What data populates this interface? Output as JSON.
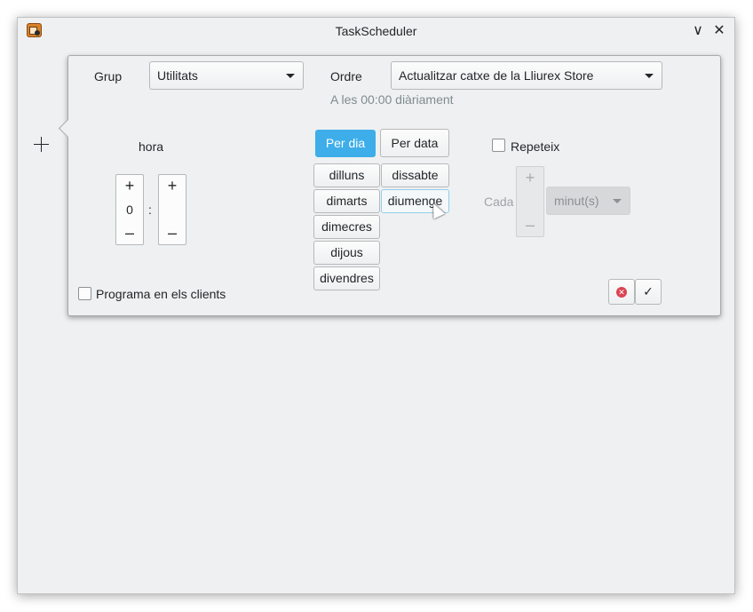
{
  "window": {
    "title": "TaskScheduler"
  },
  "titlebar": {
    "minimize_glyph": "∨",
    "close_glyph": "✕",
    "app_icon": "taskscheduler-app-icon"
  },
  "form": {
    "group_label": "Grup",
    "group_value": "Utilitats",
    "order_label": "Ordre",
    "order_value": "Actualitzar catxe de la Lliurex Store",
    "schedule_summary": "A les 00:00 diàriament",
    "hour_label": "hora",
    "hour_value": "0",
    "time_separator": ":",
    "minute_value": "",
    "spin_plus": "+",
    "spin_minus": "–",
    "mode_buttons": {
      "per_day": "Per dia",
      "per_date": "Per data"
    },
    "days": [
      "dilluns",
      "dimarts",
      "dimecres",
      "dijous",
      "divendres",
      "dissabte",
      "diumenge"
    ],
    "repeat_label": "Repeteix",
    "every_label": "Cada",
    "interval_unit": "minut(s)",
    "clients_label": "Programa en els clients",
    "cancel_glyph": "✕",
    "confirm_glyph": "✓"
  },
  "colors": {
    "accent": "#3daee9",
    "background": "#eff0f1",
    "cancel": "#da4453"
  }
}
